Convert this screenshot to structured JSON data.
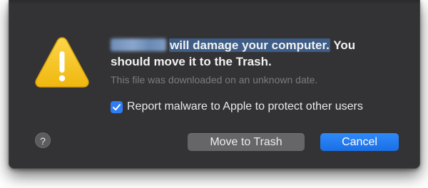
{
  "dialog": {
    "headline_part1": "will damage your computer.",
    "headline_part2": "You",
    "headline_line2": "should move it to the Trash.",
    "subtext": "This file was downloaded on an unknown date.",
    "checkbox": {
      "label": "Report malware to Apple to protect other users",
      "checked": true
    },
    "help_label": "?",
    "buttons": {
      "move_to_trash": "Move to Trash",
      "cancel": "Cancel"
    }
  },
  "colors": {
    "dialog_bg": "#333335",
    "accent_blue": "#2f7cf6",
    "warning_yellow": "#f5c518",
    "secondary_button": "#666669"
  },
  "icons": {
    "warning": "warning-triangle-icon",
    "checkmark": "checkmark-icon",
    "help": "help-icon"
  }
}
